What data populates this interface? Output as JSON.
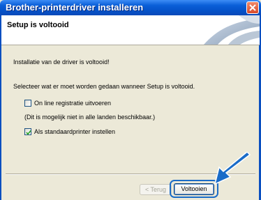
{
  "window": {
    "title": "Brother-printerdriver installeren",
    "colors": {
      "titlebar": "#0552c8",
      "close": "#d8492a",
      "dialog_bg": "#ece9d8",
      "arrow": "#1a6cc8"
    }
  },
  "header": {
    "title": "Setup is voltooid"
  },
  "content": {
    "line1": "Installatie van de driver is voltooid!",
    "line2": "Selecteer wat er moet worden gedaan wanneer Setup is voltooid.",
    "options": [
      {
        "label": "On line registratie uitvoeren",
        "checked": false
      },
      {
        "label": "Als standaardprinter instellen",
        "checked": true
      }
    ],
    "note": "(Dit is mogelijk niet in alle landen beschikbaar.)"
  },
  "buttons": {
    "back_label": "< Terug",
    "finish_label": "Voltooien"
  },
  "icons": [
    "close-icon",
    "checkmark-icon",
    "pointer-arrow-icon",
    "header-swirl-graphic"
  ]
}
